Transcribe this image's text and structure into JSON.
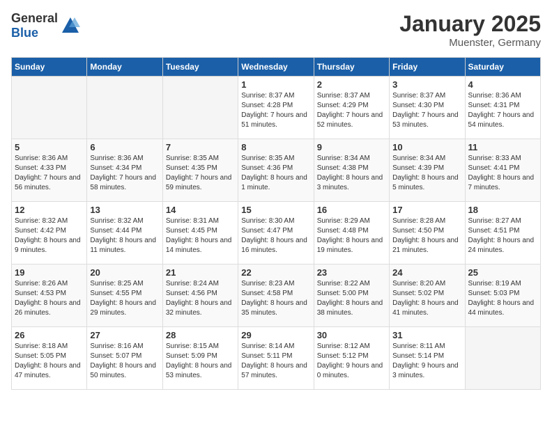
{
  "header": {
    "logo_general": "General",
    "logo_blue": "Blue",
    "title": "January 2025",
    "subtitle": "Muenster, Germany"
  },
  "days_of_week": [
    "Sunday",
    "Monday",
    "Tuesday",
    "Wednesday",
    "Thursday",
    "Friday",
    "Saturday"
  ],
  "weeks": [
    [
      {
        "day": "",
        "info": ""
      },
      {
        "day": "",
        "info": ""
      },
      {
        "day": "",
        "info": ""
      },
      {
        "day": "1",
        "info": "Sunrise: 8:37 AM\nSunset: 4:28 PM\nDaylight: 7 hours and 51 minutes."
      },
      {
        "day": "2",
        "info": "Sunrise: 8:37 AM\nSunset: 4:29 PM\nDaylight: 7 hours and 52 minutes."
      },
      {
        "day": "3",
        "info": "Sunrise: 8:37 AM\nSunset: 4:30 PM\nDaylight: 7 hours and 53 minutes."
      },
      {
        "day": "4",
        "info": "Sunrise: 8:36 AM\nSunset: 4:31 PM\nDaylight: 7 hours and 54 minutes."
      }
    ],
    [
      {
        "day": "5",
        "info": "Sunrise: 8:36 AM\nSunset: 4:33 PM\nDaylight: 7 hours and 56 minutes."
      },
      {
        "day": "6",
        "info": "Sunrise: 8:36 AM\nSunset: 4:34 PM\nDaylight: 7 hours and 58 minutes."
      },
      {
        "day": "7",
        "info": "Sunrise: 8:35 AM\nSunset: 4:35 PM\nDaylight: 7 hours and 59 minutes."
      },
      {
        "day": "8",
        "info": "Sunrise: 8:35 AM\nSunset: 4:36 PM\nDaylight: 8 hours and 1 minute."
      },
      {
        "day": "9",
        "info": "Sunrise: 8:34 AM\nSunset: 4:38 PM\nDaylight: 8 hours and 3 minutes."
      },
      {
        "day": "10",
        "info": "Sunrise: 8:34 AM\nSunset: 4:39 PM\nDaylight: 8 hours and 5 minutes."
      },
      {
        "day": "11",
        "info": "Sunrise: 8:33 AM\nSunset: 4:41 PM\nDaylight: 8 hours and 7 minutes."
      }
    ],
    [
      {
        "day": "12",
        "info": "Sunrise: 8:32 AM\nSunset: 4:42 PM\nDaylight: 8 hours and 9 minutes."
      },
      {
        "day": "13",
        "info": "Sunrise: 8:32 AM\nSunset: 4:44 PM\nDaylight: 8 hours and 11 minutes."
      },
      {
        "day": "14",
        "info": "Sunrise: 8:31 AM\nSunset: 4:45 PM\nDaylight: 8 hours and 14 minutes."
      },
      {
        "day": "15",
        "info": "Sunrise: 8:30 AM\nSunset: 4:47 PM\nDaylight: 8 hours and 16 minutes."
      },
      {
        "day": "16",
        "info": "Sunrise: 8:29 AM\nSunset: 4:48 PM\nDaylight: 8 hours and 19 minutes."
      },
      {
        "day": "17",
        "info": "Sunrise: 8:28 AM\nSunset: 4:50 PM\nDaylight: 8 hours and 21 minutes."
      },
      {
        "day": "18",
        "info": "Sunrise: 8:27 AM\nSunset: 4:51 PM\nDaylight: 8 hours and 24 minutes."
      }
    ],
    [
      {
        "day": "19",
        "info": "Sunrise: 8:26 AM\nSunset: 4:53 PM\nDaylight: 8 hours and 26 minutes."
      },
      {
        "day": "20",
        "info": "Sunrise: 8:25 AM\nSunset: 4:55 PM\nDaylight: 8 hours and 29 minutes."
      },
      {
        "day": "21",
        "info": "Sunrise: 8:24 AM\nSunset: 4:56 PM\nDaylight: 8 hours and 32 minutes."
      },
      {
        "day": "22",
        "info": "Sunrise: 8:23 AM\nSunset: 4:58 PM\nDaylight: 8 hours and 35 minutes."
      },
      {
        "day": "23",
        "info": "Sunrise: 8:22 AM\nSunset: 5:00 PM\nDaylight: 8 hours and 38 minutes."
      },
      {
        "day": "24",
        "info": "Sunrise: 8:20 AM\nSunset: 5:02 PM\nDaylight: 8 hours and 41 minutes."
      },
      {
        "day": "25",
        "info": "Sunrise: 8:19 AM\nSunset: 5:03 PM\nDaylight: 8 hours and 44 minutes."
      }
    ],
    [
      {
        "day": "26",
        "info": "Sunrise: 8:18 AM\nSunset: 5:05 PM\nDaylight: 8 hours and 47 minutes."
      },
      {
        "day": "27",
        "info": "Sunrise: 8:16 AM\nSunset: 5:07 PM\nDaylight: 8 hours and 50 minutes."
      },
      {
        "day": "28",
        "info": "Sunrise: 8:15 AM\nSunset: 5:09 PM\nDaylight: 8 hours and 53 minutes."
      },
      {
        "day": "29",
        "info": "Sunrise: 8:14 AM\nSunset: 5:11 PM\nDaylight: 8 hours and 57 minutes."
      },
      {
        "day": "30",
        "info": "Sunrise: 8:12 AM\nSunset: 5:12 PM\nDaylight: 9 hours and 0 minutes."
      },
      {
        "day": "31",
        "info": "Sunrise: 8:11 AM\nSunset: 5:14 PM\nDaylight: 9 hours and 3 minutes."
      },
      {
        "day": "",
        "info": ""
      }
    ]
  ]
}
